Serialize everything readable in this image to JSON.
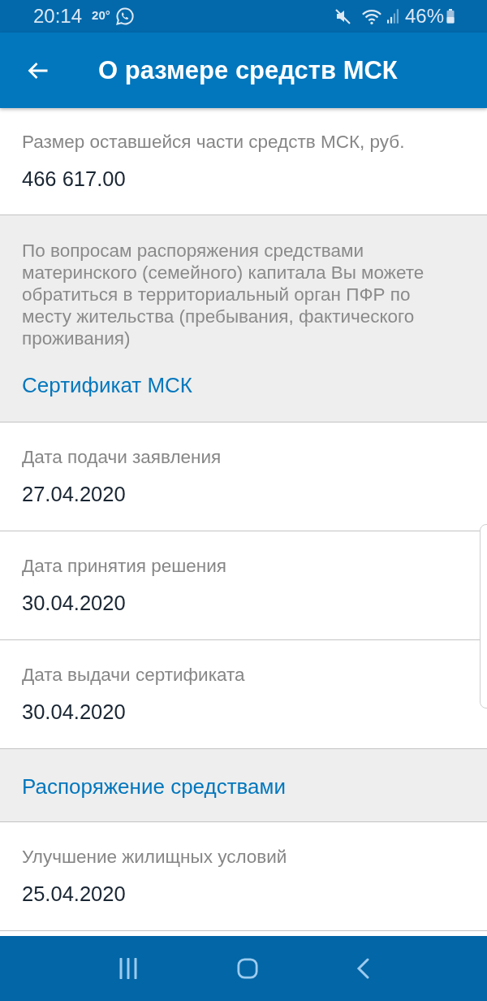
{
  "status_bar": {
    "time": "20:14",
    "temperature": "20°",
    "battery": "46%"
  },
  "app_bar": {
    "title": "О размере средств МСК"
  },
  "sections": [
    {
      "kind": "field",
      "label": "Размер оставшейся части средств МСК, руб.",
      "value": "466 617.00"
    },
    {
      "kind": "notice",
      "text": "По вопросам распоряжения средствами материнского (семейного) капитала Вы можете обратиться в территориальный орган ПФР по месту жительства (пребывания, фактического проживания)",
      "link": "Сертификат МСК"
    },
    {
      "kind": "field",
      "label": "Дата подачи заявления",
      "value": "27.04.2020"
    },
    {
      "kind": "field",
      "label": "Дата принятия решения",
      "value": "30.04.2020"
    },
    {
      "kind": "field",
      "label": "Дата выдачи сертификата",
      "value": "30.04.2020"
    },
    {
      "kind": "link",
      "text": "Распоряжение средствами"
    },
    {
      "kind": "field",
      "label": "Улучшение жилищных условий",
      "value": "25.04.2020"
    }
  ]
}
